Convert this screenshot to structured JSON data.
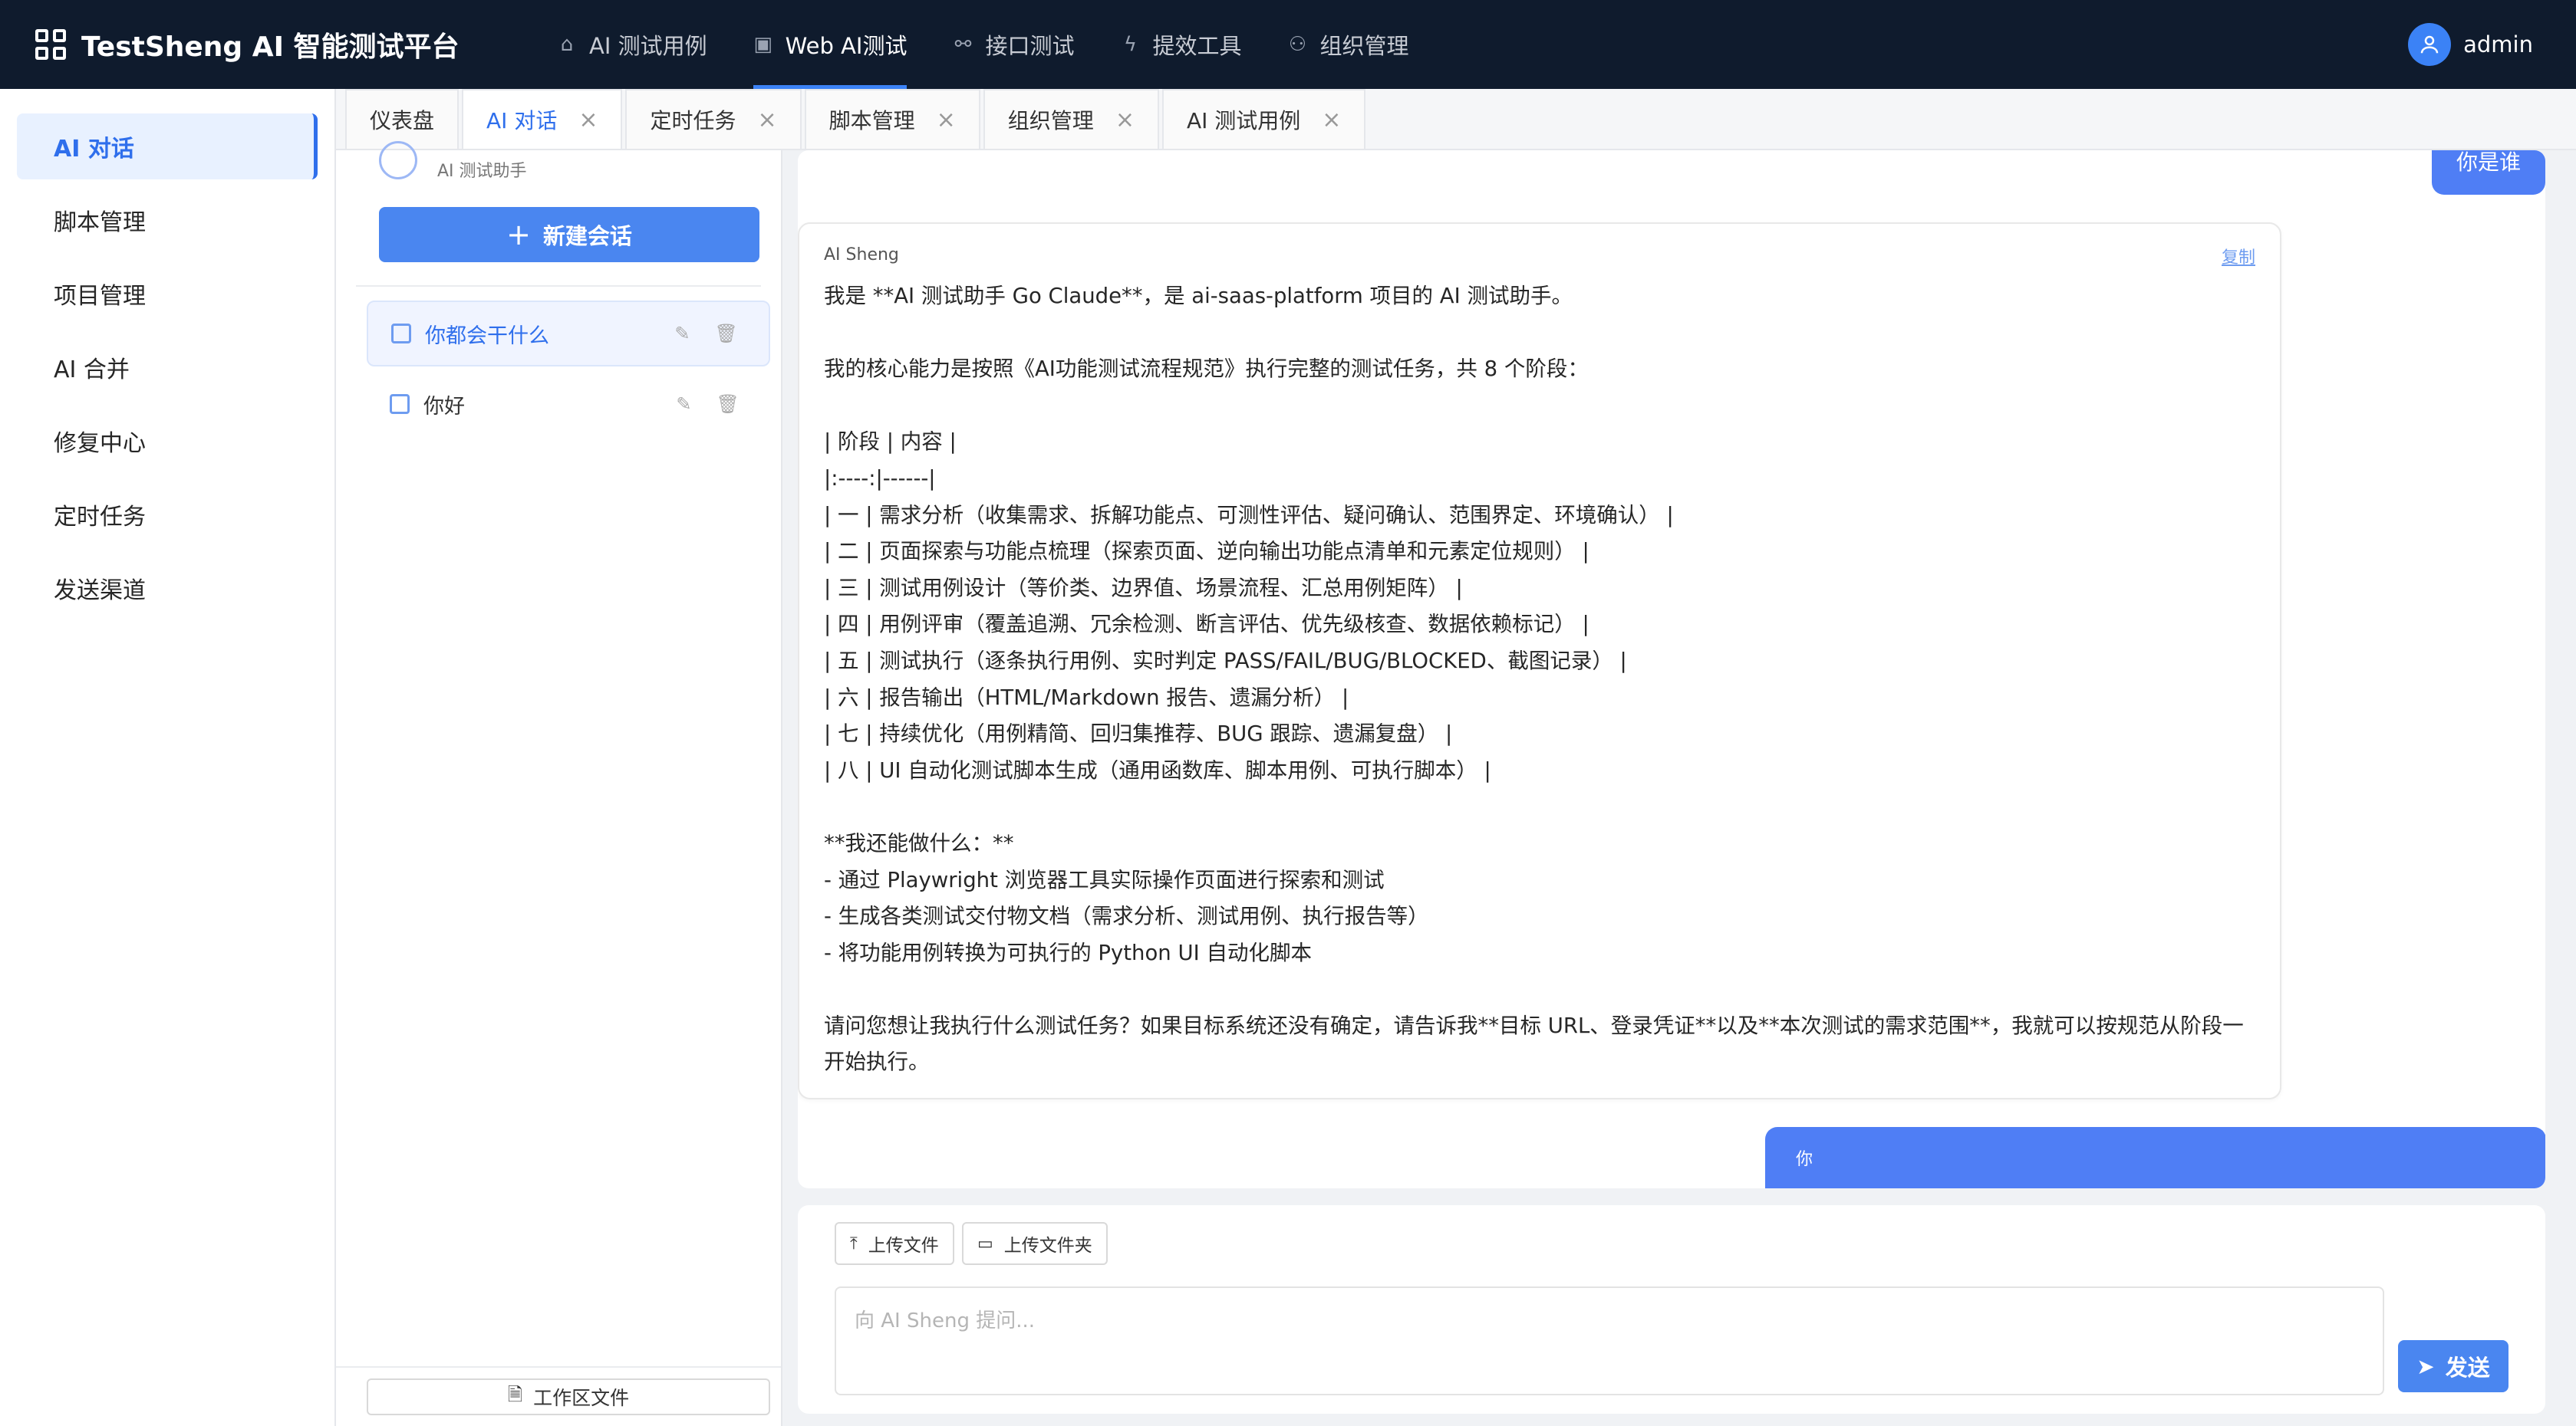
{
  "header": {
    "app_title": "TestSheng AI 智能测试平台",
    "nav": [
      {
        "label": "AI 测试用例",
        "icon": "home-icon"
      },
      {
        "label": "Web AI测试",
        "icon": "terminal-icon"
      },
      {
        "label": "接口测试",
        "icon": "link-icon"
      },
      {
        "label": "提效工具",
        "icon": "lightning-icon"
      },
      {
        "label": "组织管理",
        "icon": "users-icon"
      }
    ],
    "active_nav": "Web AI测试",
    "user": "admin"
  },
  "sidebar": {
    "items": [
      {
        "label": "AI 对话"
      },
      {
        "label": "脚本管理"
      },
      {
        "label": "项目管理"
      },
      {
        "label": "AI 合并"
      },
      {
        "label": "修复中心"
      },
      {
        "label": "定时任务"
      },
      {
        "label": "发送渠道"
      }
    ],
    "active": "AI 对话"
  },
  "tabs": [
    {
      "label": "仪表盘",
      "closable": false
    },
    {
      "label": "AI 对话",
      "closable": true
    },
    {
      "label": "定时任务",
      "closable": true
    },
    {
      "label": "脚本管理",
      "closable": true
    },
    {
      "label": "组织管理",
      "closable": true
    },
    {
      "label": "AI 测试用例",
      "closable": true
    }
  ],
  "conversations": {
    "bot_subtitle": "AI 测试助手",
    "new_chat_label": "新建会话",
    "items": [
      {
        "title": "你都会干什么",
        "active": true
      },
      {
        "title": "你好",
        "active": false
      }
    ],
    "workspace_button": "工作区文件"
  },
  "chat": {
    "user_message_top": "你是谁",
    "ai_name": "AI Sheng",
    "copy_label": "复制",
    "ai_message": "我是 **AI 测试助手 Go Claude**，是 ai-saas-platform 项目的 AI 测试助手。\n\n我的核心能力是按照《AI功能测试流程规范》执行完整的测试任务，共 8 个阶段：\n\n| 阶段 | 内容 |\n|:----:|------|\n| 一 | 需求分析（收集需求、拆解功能点、可测性评估、疑问确认、范围界定、环境确认） |\n| 二 | 页面探索与功能点梳理（探索页面、逆向输出功能点清单和元素定位规则） |\n| 三 | 测试用例设计（等价类、边界值、场景流程、汇总用例矩阵） |\n| 四 | 用例评审（覆盖追溯、冗余检测、断言评估、优先级核查、数据依赖标记） |\n| 五 | 测试执行（逐条执行用例、实时判定 PASS/FAIL/BUG/BLOCKED、截图记录） |\n| 六 | 报告输出（HTML/Markdown 报告、遗漏分析） |\n| 七 | 持续优化（用例精简、回归集推荐、BUG 跟踪、遗漏复盘） |\n| 八 | UI 自动化测试脚本生成（通用函数库、脚本用例、可执行脚本） |\n\n**我还能做什么：**\n- 通过 Playwright 浏览器工具实际操作页面进行探索和测试\n- 生成各类测试交付物文档（需求分析、测试用例、执行报告等）\n- 将功能用例转换为可执行的 Python UI 自动化脚本\n\n请问您想让我执行什么测试任务？如果目标系统还没有确定，请告诉我**目标 URL、登录凭证**以及**本次测试的需求范围**，我就可以按规范从阶段一开始执行。",
    "user_message_bottom": "你"
  },
  "input": {
    "upload_file_label": "上传文件",
    "upload_folder_label": "上传文件夹",
    "placeholder": "向 AI Sheng 提问...",
    "value": "",
    "send_label": "发送"
  },
  "colors": {
    "topbar_bg": "#0f1b2d",
    "accent": "#4a86f0",
    "user_bubble": "#4f7ef5"
  }
}
